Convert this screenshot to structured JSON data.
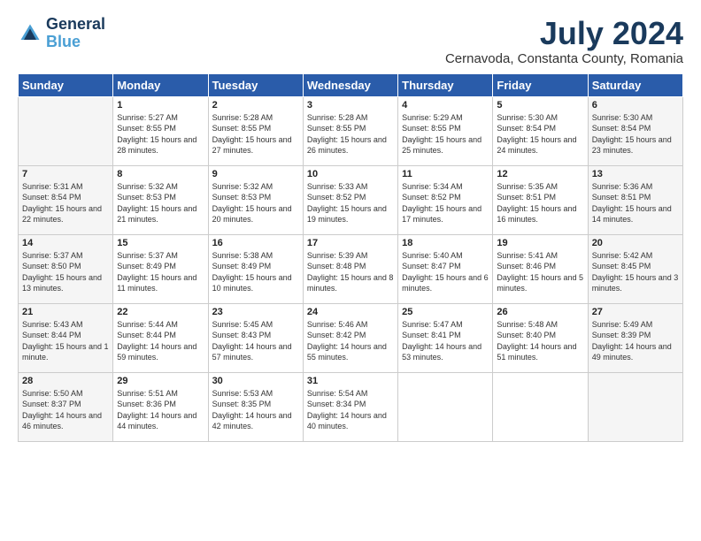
{
  "logo": {
    "line1": "General",
    "line2": "Blue"
  },
  "title": "July 2024",
  "subtitle": "Cernavoda, Constanta County, Romania",
  "weekdays": [
    "Sunday",
    "Monday",
    "Tuesday",
    "Wednesday",
    "Thursday",
    "Friday",
    "Saturday"
  ],
  "weeks": [
    [
      {
        "day": "",
        "sunrise": "",
        "sunset": "",
        "daylight": ""
      },
      {
        "day": "1",
        "sunrise": "Sunrise: 5:27 AM",
        "sunset": "Sunset: 8:55 PM",
        "daylight": "Daylight: 15 hours and 28 minutes."
      },
      {
        "day": "2",
        "sunrise": "Sunrise: 5:28 AM",
        "sunset": "Sunset: 8:55 PM",
        "daylight": "Daylight: 15 hours and 27 minutes."
      },
      {
        "day": "3",
        "sunrise": "Sunrise: 5:28 AM",
        "sunset": "Sunset: 8:55 PM",
        "daylight": "Daylight: 15 hours and 26 minutes."
      },
      {
        "day": "4",
        "sunrise": "Sunrise: 5:29 AM",
        "sunset": "Sunset: 8:55 PM",
        "daylight": "Daylight: 15 hours and 25 minutes."
      },
      {
        "day": "5",
        "sunrise": "Sunrise: 5:30 AM",
        "sunset": "Sunset: 8:54 PM",
        "daylight": "Daylight: 15 hours and 24 minutes."
      },
      {
        "day": "6",
        "sunrise": "Sunrise: 5:30 AM",
        "sunset": "Sunset: 8:54 PM",
        "daylight": "Daylight: 15 hours and 23 minutes."
      }
    ],
    [
      {
        "day": "7",
        "sunrise": "Sunrise: 5:31 AM",
        "sunset": "Sunset: 8:54 PM",
        "daylight": "Daylight: 15 hours and 22 minutes."
      },
      {
        "day": "8",
        "sunrise": "Sunrise: 5:32 AM",
        "sunset": "Sunset: 8:53 PM",
        "daylight": "Daylight: 15 hours and 21 minutes."
      },
      {
        "day": "9",
        "sunrise": "Sunrise: 5:32 AM",
        "sunset": "Sunset: 8:53 PM",
        "daylight": "Daylight: 15 hours and 20 minutes."
      },
      {
        "day": "10",
        "sunrise": "Sunrise: 5:33 AM",
        "sunset": "Sunset: 8:52 PM",
        "daylight": "Daylight: 15 hours and 19 minutes."
      },
      {
        "day": "11",
        "sunrise": "Sunrise: 5:34 AM",
        "sunset": "Sunset: 8:52 PM",
        "daylight": "Daylight: 15 hours and 17 minutes."
      },
      {
        "day": "12",
        "sunrise": "Sunrise: 5:35 AM",
        "sunset": "Sunset: 8:51 PM",
        "daylight": "Daylight: 15 hours and 16 minutes."
      },
      {
        "day": "13",
        "sunrise": "Sunrise: 5:36 AM",
        "sunset": "Sunset: 8:51 PM",
        "daylight": "Daylight: 15 hours and 14 minutes."
      }
    ],
    [
      {
        "day": "14",
        "sunrise": "Sunrise: 5:37 AM",
        "sunset": "Sunset: 8:50 PM",
        "daylight": "Daylight: 15 hours and 13 minutes."
      },
      {
        "day": "15",
        "sunrise": "Sunrise: 5:37 AM",
        "sunset": "Sunset: 8:49 PM",
        "daylight": "Daylight: 15 hours and 11 minutes."
      },
      {
        "day": "16",
        "sunrise": "Sunrise: 5:38 AM",
        "sunset": "Sunset: 8:49 PM",
        "daylight": "Daylight: 15 hours and 10 minutes."
      },
      {
        "day": "17",
        "sunrise": "Sunrise: 5:39 AM",
        "sunset": "Sunset: 8:48 PM",
        "daylight": "Daylight: 15 hours and 8 minutes."
      },
      {
        "day": "18",
        "sunrise": "Sunrise: 5:40 AM",
        "sunset": "Sunset: 8:47 PM",
        "daylight": "Daylight: 15 hours and 6 minutes."
      },
      {
        "day": "19",
        "sunrise": "Sunrise: 5:41 AM",
        "sunset": "Sunset: 8:46 PM",
        "daylight": "Daylight: 15 hours and 5 minutes."
      },
      {
        "day": "20",
        "sunrise": "Sunrise: 5:42 AM",
        "sunset": "Sunset: 8:45 PM",
        "daylight": "Daylight: 15 hours and 3 minutes."
      }
    ],
    [
      {
        "day": "21",
        "sunrise": "Sunrise: 5:43 AM",
        "sunset": "Sunset: 8:44 PM",
        "daylight": "Daylight: 15 hours and 1 minute."
      },
      {
        "day": "22",
        "sunrise": "Sunrise: 5:44 AM",
        "sunset": "Sunset: 8:44 PM",
        "daylight": "Daylight: 14 hours and 59 minutes."
      },
      {
        "day": "23",
        "sunrise": "Sunrise: 5:45 AM",
        "sunset": "Sunset: 8:43 PM",
        "daylight": "Daylight: 14 hours and 57 minutes."
      },
      {
        "day": "24",
        "sunrise": "Sunrise: 5:46 AM",
        "sunset": "Sunset: 8:42 PM",
        "daylight": "Daylight: 14 hours and 55 minutes."
      },
      {
        "day": "25",
        "sunrise": "Sunrise: 5:47 AM",
        "sunset": "Sunset: 8:41 PM",
        "daylight": "Daylight: 14 hours and 53 minutes."
      },
      {
        "day": "26",
        "sunrise": "Sunrise: 5:48 AM",
        "sunset": "Sunset: 8:40 PM",
        "daylight": "Daylight: 14 hours and 51 minutes."
      },
      {
        "day": "27",
        "sunrise": "Sunrise: 5:49 AM",
        "sunset": "Sunset: 8:39 PM",
        "daylight": "Daylight: 14 hours and 49 minutes."
      }
    ],
    [
      {
        "day": "28",
        "sunrise": "Sunrise: 5:50 AM",
        "sunset": "Sunset: 8:37 PM",
        "daylight": "Daylight: 14 hours and 46 minutes."
      },
      {
        "day": "29",
        "sunrise": "Sunrise: 5:51 AM",
        "sunset": "Sunset: 8:36 PM",
        "daylight": "Daylight: 14 hours and 44 minutes."
      },
      {
        "day": "30",
        "sunrise": "Sunrise: 5:53 AM",
        "sunset": "Sunset: 8:35 PM",
        "daylight": "Daylight: 14 hours and 42 minutes."
      },
      {
        "day": "31",
        "sunrise": "Sunrise: 5:54 AM",
        "sunset": "Sunset: 8:34 PM",
        "daylight": "Daylight: 14 hours and 40 minutes."
      },
      {
        "day": "",
        "sunrise": "",
        "sunset": "",
        "daylight": ""
      },
      {
        "day": "",
        "sunrise": "",
        "sunset": "",
        "daylight": ""
      },
      {
        "day": "",
        "sunrise": "",
        "sunset": "",
        "daylight": ""
      }
    ]
  ]
}
